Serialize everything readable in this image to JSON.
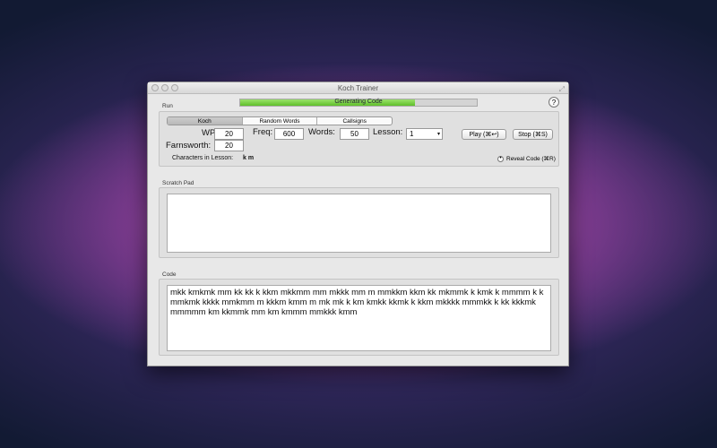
{
  "window": {
    "title": "Koch Trainer"
  },
  "progress": {
    "label": "Generating Code",
    "fraction": 0.74
  },
  "run": {
    "label": "Run",
    "tabs": [
      {
        "label": "Koch",
        "selected": true
      },
      {
        "label": "Random Words",
        "selected": false
      },
      {
        "label": "Callsigns",
        "selected": false
      }
    ],
    "wpm_label": "WPM:",
    "wpm": "20",
    "freq_label": "Freq:",
    "freq": "600",
    "words_label": "Words:",
    "words": "50",
    "lesson_label": "Lesson:",
    "lesson": "1",
    "farnsworth_label": "Farnsworth:",
    "farnsworth": "20",
    "play": "Play (⌘↩)",
    "stop": "Stop (⌘S)",
    "chars_label": "Characters in Lesson:",
    "chars": "k m",
    "reveal": "Reveal Code (⌘R)"
  },
  "scratch": {
    "label": "Scratch Pad",
    "text": ""
  },
  "code": {
    "label": "Code",
    "text": "mkk kmkmk mm kk kk k kkm mkkmm mm mkkk mm m mmkkm kkm kk mkmmk k kmk k mmmm k k mmkmk kkkk mmkmm m kkkm kmm m mk mk k km kmkk kkmk k kkm mkkkk mmmkk k kk kkkmk mmmmm km kkmmk mm km kmmm mmkkk kmm"
  },
  "help": "?"
}
